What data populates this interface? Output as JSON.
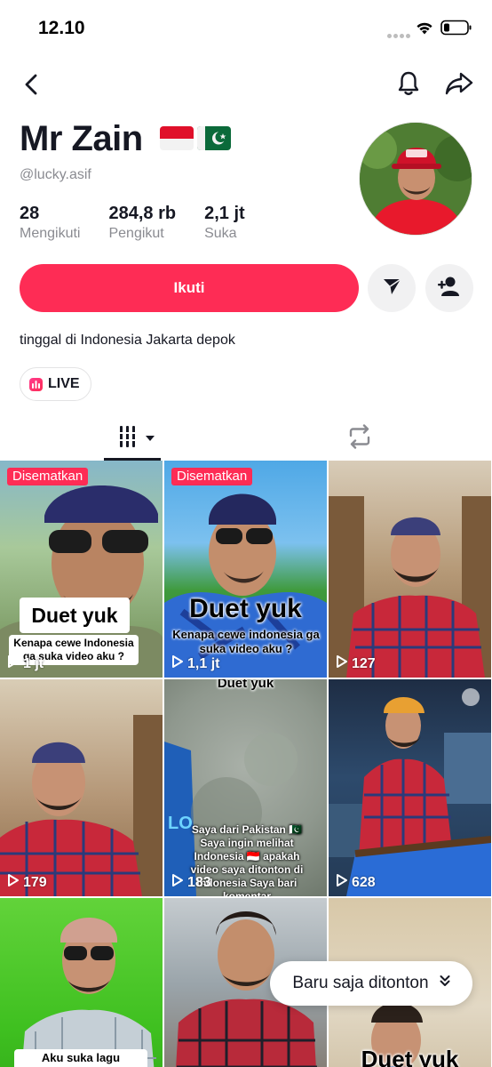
{
  "status_bar": {
    "time": "12.10"
  },
  "profile": {
    "name": "Mr Zain",
    "username": "@lucky.asif",
    "stats": [
      {
        "value": "28",
        "label": "Mengikuti"
      },
      {
        "value": "284,8 rb",
        "label": "Pengikut"
      },
      {
        "value": "2,1 jt",
        "label": "Suka"
      }
    ],
    "bio": "tinggal di Indonesia Jakarta depok",
    "live_label": "LIVE"
  },
  "actions": {
    "follow_label": "Ikuti"
  },
  "videos": [
    {
      "pinned_label": "Disematkan",
      "views": "1 jt",
      "caption_title": "Duet yuk",
      "caption_text": "Kenapa cewe Indonesia ga suka video aku ?"
    },
    {
      "pinned_label": "Disematkan",
      "views": "1,1 jt",
      "caption_title": "Duet yuk",
      "caption_text": "Kenapa cewe indonesia ga suka video aku ?"
    },
    {
      "views": "127"
    },
    {
      "views": "179"
    },
    {
      "views": "183",
      "caption_title": "Duet yuk",
      "caption_text": "Saya dari Pakistan 🇵🇰 Saya ingin melihat Indonesia 🇮🇩 apakah video saya ditonton di Indonesia Saya bari komentar"
    },
    {
      "views": "628"
    },
    {
      "caption_text": "Aku suka lagu indonesia"
    },
    {},
    {
      "caption_title": "Duet yuk"
    }
  ],
  "recently_watched": {
    "label": "Baru saja ditonton"
  },
  "colors": {
    "accent": "#fe2c55",
    "text": "#161823",
    "muted": "#8a8b91"
  }
}
